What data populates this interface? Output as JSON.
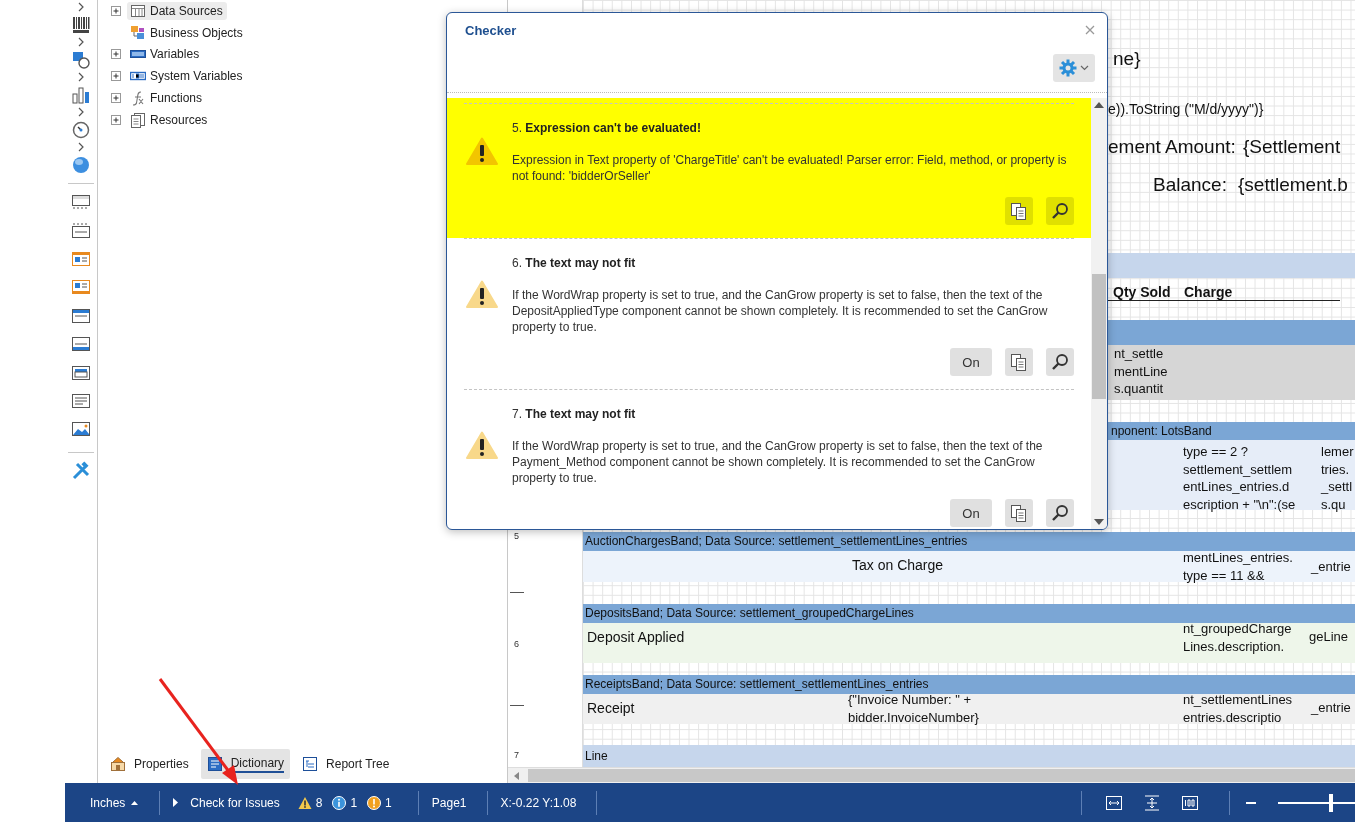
{
  "dictionary": {
    "items": [
      {
        "label": "Data Sources",
        "kind": "group",
        "expanded": false,
        "selected": true
      },
      {
        "label": "Business Objects",
        "kind": "object",
        "selected": false
      },
      {
        "label": "Variables",
        "kind": "group",
        "expanded": false,
        "selected": false
      },
      {
        "label": "System Variables",
        "kind": "group",
        "expanded": false,
        "selected": false
      },
      {
        "label": "Functions",
        "kind": "group",
        "expanded": false,
        "selected": false
      },
      {
        "label": "Resources",
        "kind": "group",
        "expanded": false,
        "selected": false
      }
    ],
    "tabs": [
      {
        "label": "Properties",
        "selected": false
      },
      {
        "label": "Dictionary",
        "selected": true
      },
      {
        "label": "Report Tree",
        "selected": false
      }
    ]
  },
  "designer": {
    "ruler": [
      "5",
      "6",
      "7"
    ],
    "bands": [
      {
        "color": "#c6d6ec"
      },
      {
        "color": "#7ba6d5"
      },
      {
        "label": "nponent: LotsBand",
        "color": "#7ba6d5"
      },
      {
        "label": "AuctionChargesBand; Data Source: settlement_settlementLines_entries",
        "color": "#7ba6d5"
      },
      {
        "label": "DepositsBand; Data Source: settlement_groupedChargeLines",
        "color": "#7ba6d5"
      },
      {
        "label": "ReceiptsBand; Data Source: settlement_settlementLines_entries",
        "color": "#7ba6d5"
      },
      {
        "label": "Line",
        "color": "#c6d6ec"
      }
    ],
    "components": [
      {
        "kind": "large",
        "lines": [
          "ne}"
        ]
      },
      {
        "kind": "plain",
        "lines": [
          "e)).ToString (\"M/d/yyyy\")}"
        ]
      },
      {
        "kind": "large",
        "lines": [
          "ement Amount:"
        ]
      },
      {
        "kind": "large",
        "lines": [
          "{Settlement"
        ]
      },
      {
        "kind": "large",
        "lines": [
          "Balance:"
        ]
      },
      {
        "kind": "large",
        "lines": [
          "{settlement.b"
        ]
      },
      {
        "kind": "heading",
        "lines": [
          "Qty Sold"
        ]
      },
      {
        "kind": "heading",
        "lines": [
          "Charge"
        ]
      },
      {
        "kind": "small",
        "lines": [
          "nt_settle",
          "mentLine",
          "s.quantit"
        ]
      },
      {
        "kind": "small",
        "lines": [
          "type == 2 ?",
          "settlement_settlem",
          "entLines_entries.d",
          "escription + \"\\n\":(se"
        ]
      },
      {
        "kind": "small",
        "lines": [
          "lemer",
          "tries.",
          "_settl",
          "s.qu"
        ]
      },
      {
        "kind": "plain",
        "lines": [
          "Tax on Charge"
        ]
      },
      {
        "kind": "small",
        "lines": [
          "mentLines_entries.",
          "type == 11 &&"
        ]
      },
      {
        "kind": "small",
        "lines": [
          "_entrie"
        ]
      },
      {
        "kind": "plain",
        "lines": [
          "Deposit Applied"
        ]
      },
      {
        "kind": "small",
        "lines": [
          "nt_groupedCharge",
          "Lines.description."
        ]
      },
      {
        "kind": "small",
        "lines": [
          "geLine"
        ]
      },
      {
        "kind": "plain",
        "lines": [
          "Receipt"
        ]
      },
      {
        "kind": "small",
        "lines": [
          "{\"Invoice Number: \" +",
          "bidder.InvoiceNumber}"
        ]
      },
      {
        "kind": "small",
        "lines": [
          "nt_settlementLines",
          "entries.descriptio"
        ]
      },
      {
        "kind": "small",
        "lines": [
          "_entrie"
        ]
      }
    ]
  },
  "checker": {
    "title": "Checker",
    "issues": [
      {
        "heading": "5. **Expression can't be evaluated!**",
        "message": "Expression in Text property of 'ChargeTitle' can't be evaluated! Parser error: Field, method, or property is not found: 'bidderOrSeller'",
        "selected": true,
        "actions": [
          {
            "kind": "copy"
          },
          {
            "kind": "locate"
          }
        ]
      },
      {
        "heading": "6. **The text may not fit**",
        "message": "If the WordWrap property is set to true, and the CanGrow property is set to false, then the text of the DepositAppliedType component cannot be shown completely. It is recommended to set the CanGrow property to true.",
        "selected": false,
        "actions": [
          {
            "kind": "toggle",
            "label": "On"
          },
          {
            "kind": "copy"
          },
          {
            "kind": "locate"
          }
        ]
      },
      {
        "heading": "7. **The text may not fit**",
        "message": "If the WordWrap property is set to true, and the CanGrow property is set to false, then the text of the Payment_Method component cannot be shown completely. It is recommended to set the CanGrow property to true.",
        "selected": false,
        "actions": [
          {
            "kind": "toggle",
            "label": "On"
          },
          {
            "kind": "copy"
          },
          {
            "kind": "locate"
          }
        ]
      }
    ]
  },
  "status_bar": {
    "units": "Inches",
    "check_label": "Check for Issues",
    "counts": [
      {
        "kind": "warning",
        "value": "8"
      },
      {
        "kind": "info",
        "value": "1"
      },
      {
        "kind": "notice",
        "value": "1"
      }
    ],
    "page": "Page1",
    "coordinates": "X:-0.22 Y:1.08",
    "zoom": {
      "level": 0.69
    }
  }
}
